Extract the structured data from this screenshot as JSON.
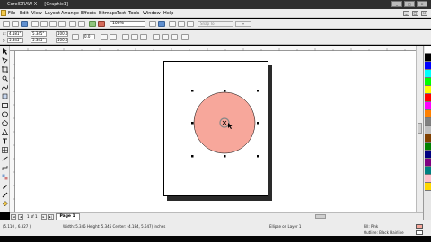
{
  "window": {
    "title": "CorelDRAW X — [Graphic1]",
    "controls": [
      "_",
      "□",
      "×"
    ]
  },
  "menubar": {
    "items": [
      "File",
      "Edit",
      "View",
      "Layout",
      "Arrange",
      "Effects",
      "Bitmaps",
      "Text",
      "Tools",
      "Window",
      "Help"
    ],
    "doc_controls": [
      "_",
      "□",
      "×"
    ]
  },
  "toolbar": {
    "zoom_value": "100%",
    "snap_label": "Snap To",
    "snap_extra": "▾"
  },
  "propbar": {
    "x_label": "x:",
    "x_value": "4.181\"",
    "y_label": "y:",
    "y_value": "5.845\"",
    "w_value": "5.345\"",
    "h_value": "5.345\"",
    "scale_x": "100.0",
    "scale_y": "100.0",
    "angle": "0.0"
  },
  "pagenav": {
    "first": "|◂",
    "prev": "◂",
    "count": "1 of 1",
    "next": "▸",
    "last": "▸|",
    "tab_label": "Page 1"
  },
  "status": {
    "coords": "(5.110 , 6.327 )",
    "object_info": "Width: 5.345  Height: 5.345  Center: (4.184, 5.647) inches",
    "layer_info": "Ellipse on Layer 1",
    "fill_info": "Fill: Pink",
    "outline_info": "Outline: Black  Hairline"
  },
  "colors": {
    "circle_fill": "#f7a79b",
    "circle_outline": "#000000",
    "selection_handle": "#000000",
    "center_marker": "#888888"
  },
  "palette_colors": [
    "#ffffff",
    "#000000",
    "#0000ff",
    "#00ffff",
    "#00ff00",
    "#ffff00",
    "#ff0000",
    "#ff00ff",
    "#ff8000",
    "#808080",
    "#c0c0c0",
    "#804000",
    "#008000",
    "#000080",
    "#800080",
    "#008080",
    "#ffc0cb",
    "#ffd700"
  ]
}
